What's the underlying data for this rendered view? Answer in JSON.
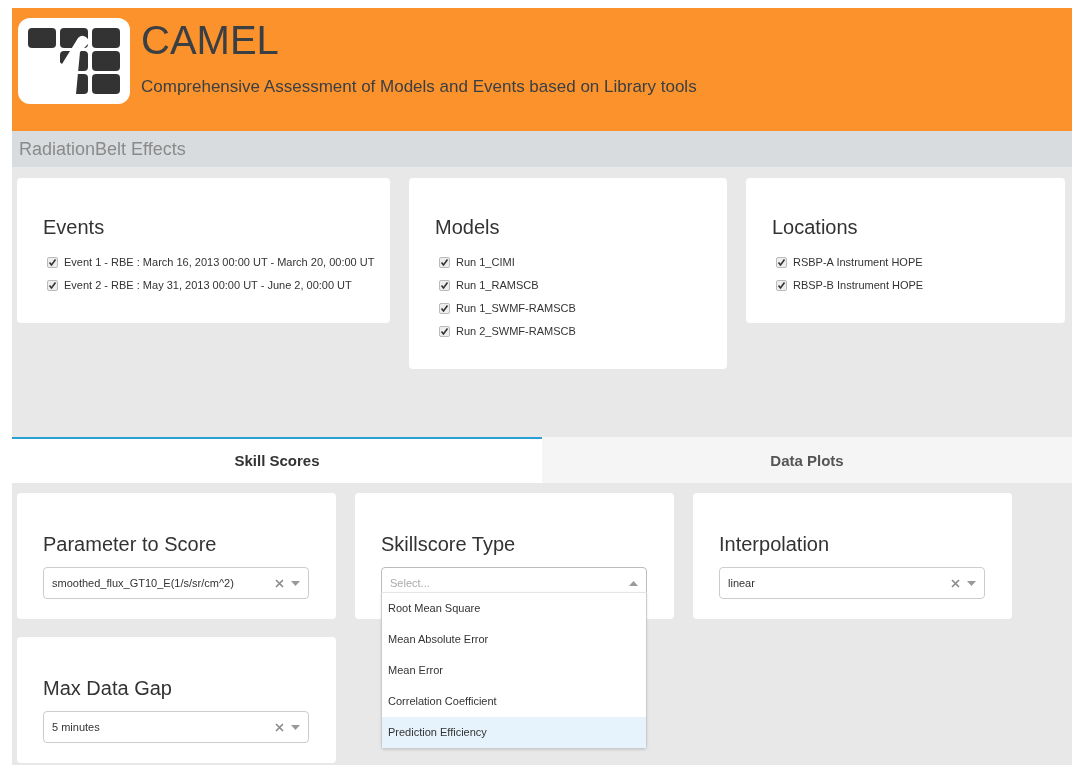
{
  "header": {
    "title": "CAMEL",
    "subtitle": "Comprehensive Assessment of Models and Events based on Library tools"
  },
  "section_title": "RadiationBelt Effects",
  "filters": [
    {
      "title": "Events",
      "items": [
        {
          "label": "Event 1 - RBE : March 16, 2013 00:00 UT - March 20, 00:00 UT",
          "checked": true
        },
        {
          "label": "Event 2 - RBE : May 31, 2013 00:00 UT - June 2, 00:00 UT",
          "checked": true
        }
      ]
    },
    {
      "title": "Models",
      "items": [
        {
          "label": "Run 1_CIMI",
          "checked": true
        },
        {
          "label": "Run 1_RAMSCB",
          "checked": true
        },
        {
          "label": "Run 1_SWMF-RAMSCB",
          "checked": true
        },
        {
          "label": "Run 2_SWMF-RAMSCB",
          "checked": true
        }
      ]
    },
    {
      "title": "Locations",
      "items": [
        {
          "label": "RSBP-A Instrument HOPE",
          "checked": true
        },
        {
          "label": "RBSP-B Instrument HOPE",
          "checked": true
        }
      ]
    }
  ],
  "tabs": [
    {
      "label": "Skill Scores",
      "selected": true
    },
    {
      "label": "Data Plots",
      "selected": false
    }
  ],
  "fields": [
    {
      "label": "Parameter to Score",
      "value": "smoothed_flux_GT10_E(1/s/sr/cm^2)",
      "expanded": false
    },
    {
      "label": "Skillscore Type",
      "placeholder": "Select...",
      "expanded": true,
      "options": [
        {
          "label": "Root Mean Square",
          "selected": false
        },
        {
          "label": "Mean Absolute Error",
          "selected": false
        },
        {
          "label": "Mean Error",
          "selected": false
        },
        {
          "label": "Correlation Coefficient",
          "selected": false
        },
        {
          "label": "Prediction Efficiency",
          "selected": true
        }
      ]
    },
    {
      "label": "Interpolation",
      "value": "linear",
      "expanded": false
    },
    {
      "label": "Max Data Gap",
      "value": "5 minutes",
      "expanded": false
    }
  ]
}
